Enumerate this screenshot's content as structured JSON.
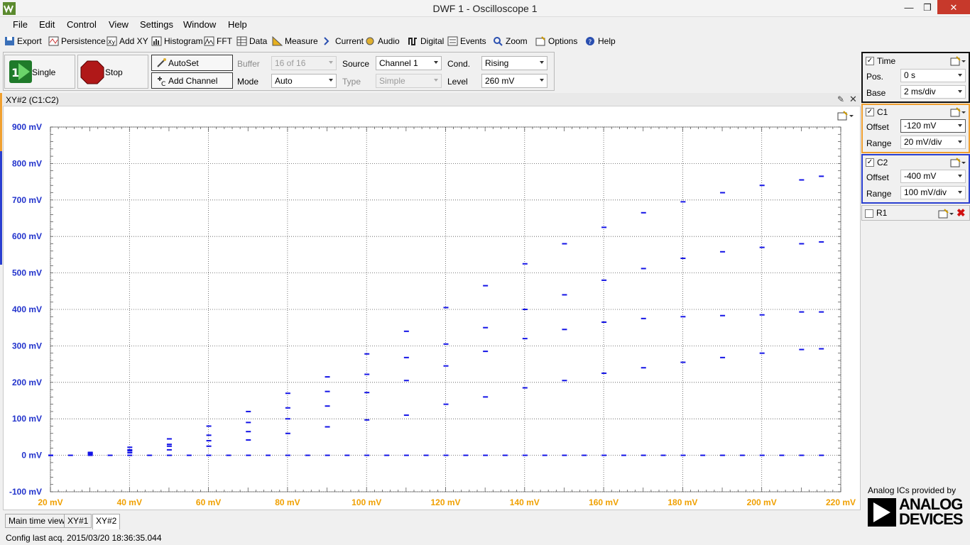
{
  "window": {
    "title": "DWF 1 - Oscilloscope 1"
  },
  "menu": [
    "File",
    "Edit",
    "Control",
    "View",
    "Settings",
    "Window",
    "Help"
  ],
  "toolbar": {
    "export": "Export",
    "persistence": "Persistence",
    "add_xy": "Add XY",
    "histogram": "Histogram",
    "fft": "FFT",
    "data": "Data",
    "measure": "Measure",
    "current": "Current",
    "audio": "Audio",
    "digital": "Digital",
    "events": "Events",
    "zoom": "Zoom",
    "options": "Options",
    "help": "Help"
  },
  "controls": {
    "single": "Single",
    "stop": "Stop",
    "autoset": "AutoSet",
    "add_channel": "Add Channel",
    "buffer_label": "Buffer",
    "buffer_value": "16 of 16",
    "mode_label": "Mode",
    "mode_value": "Auto",
    "source_label": "Source",
    "source_value": "Channel 1",
    "type_label": "Type",
    "type_value": "Simple",
    "cond_label": "Cond.",
    "cond_value": "Rising",
    "level_label": "Level",
    "level_value": "260 mV"
  },
  "plot": {
    "title": "XY#2 (C1:C2)"
  },
  "chart_data": {
    "type": "scatter",
    "title": "",
    "xlabel": "",
    "ylabel": "",
    "xlim": [
      20,
      220
    ],
    "ylim": [
      -100,
      900
    ],
    "x_ticks": [
      "20 mV",
      "40 mV",
      "60 mV",
      "80 mV",
      "100 mV",
      "120 mV",
      "140 mV",
      "160 mV",
      "180 mV",
      "200 mV",
      "220 mV"
    ],
    "y_ticks": [
      "900 mV",
      "800 mV",
      "700 mV",
      "600 mV",
      "500 mV",
      "400 mV",
      "300 mV",
      "200 mV",
      "100 mV",
      "0 mV",
      "-100 mV"
    ],
    "grid": true,
    "series": [
      {
        "color": "#1414e6",
        "x": [
          20,
          25,
          30,
          35,
          40,
          45,
          50,
          55,
          60,
          65,
          70,
          75,
          80,
          85,
          90,
          95,
          100,
          105,
          110,
          115,
          120,
          125,
          130,
          135,
          140,
          145,
          150,
          155,
          160,
          165,
          170,
          175,
          180,
          185,
          190,
          195,
          200,
          205,
          210,
          215
        ],
        "y": [
          0,
          0,
          0,
          0,
          0,
          0,
          0,
          0,
          0,
          0,
          0,
          0,
          0,
          0,
          0,
          0,
          0,
          0,
          0,
          0,
          0,
          0,
          0,
          0,
          0,
          0,
          0,
          0,
          0,
          0,
          0,
          0,
          0,
          0,
          0,
          0,
          0,
          0,
          0,
          0
        ]
      },
      {
        "color": "#1414e6",
        "x": [
          20,
          30,
          40,
          50,
          60,
          70,
          80,
          90,
          100,
          110,
          120,
          130,
          140,
          150,
          160,
          170,
          180,
          190,
          200,
          210,
          215
        ],
        "y": [
          0,
          3,
          7,
          15,
          25,
          42,
          60,
          78,
          97,
          110,
          140,
          160,
          185,
          205,
          225,
          240,
          255,
          268,
          280,
          290,
          292
        ]
      },
      {
        "color": "#1414e6",
        "x": [
          20,
          30,
          40,
          50,
          60,
          70,
          80,
          90,
          100,
          110,
          120,
          130,
          140,
          150,
          160,
          170,
          180,
          190,
          200,
          210,
          215
        ],
        "y": [
          0,
          5,
          12,
          25,
          40,
          65,
          100,
          135,
          172,
          205,
          245,
          285,
          320,
          345,
          365,
          375,
          380,
          383,
          385,
          393,
          393
        ]
      },
      {
        "color": "#1414e6",
        "x": [
          20,
          30,
          40,
          50,
          60,
          70,
          80,
          90,
          100,
          110,
          120,
          130,
          140,
          150,
          160,
          170,
          180,
          190,
          200,
          210,
          215
        ],
        "y": [
          0,
          7,
          15,
          30,
          55,
          90,
          130,
          175,
          222,
          268,
          305,
          350,
          400,
          440,
          480,
          512,
          540,
          558,
          570,
          580,
          585
        ]
      },
      {
        "color": "#1414e6",
        "x": [
          20,
          30,
          40,
          50,
          60,
          70,
          80,
          90,
          100,
          110,
          120,
          130,
          140,
          150,
          160,
          170,
          180,
          190,
          200,
          210,
          215
        ],
        "y": [
          0,
          8,
          22,
          45,
          80,
          120,
          170,
          215,
          278,
          340,
          405,
          465,
          525,
          580,
          625,
          665,
          695,
          720,
          740,
          755,
          765
        ]
      }
    ]
  },
  "tabs": [
    "Main time view",
    "XY#1",
    "XY#2"
  ],
  "status": "Config last acq. 2015/03/20  18:36:35.044",
  "right_panel": {
    "time": {
      "title": "Time",
      "pos_label": "Pos.",
      "pos_value": "0 s",
      "base_label": "Base",
      "base_value": "2 ms/div"
    },
    "c1": {
      "title": "C1",
      "offset_label": "Offset",
      "offset_value": "-120 mV",
      "range_label": "Range",
      "range_value": "20 mV/div",
      "color": "#f0a030"
    },
    "c2": {
      "title": "C2",
      "offset_label": "Offset",
      "offset_value": "-400 mV",
      "range_label": "Range",
      "range_value": "100 mV/div",
      "color": "#2a3fd0"
    },
    "r1": {
      "title": "R1"
    },
    "brand_caption": "Analog ICs provided by",
    "brand_name_1": "ANALOG",
    "brand_name_2": "DEVICES"
  }
}
